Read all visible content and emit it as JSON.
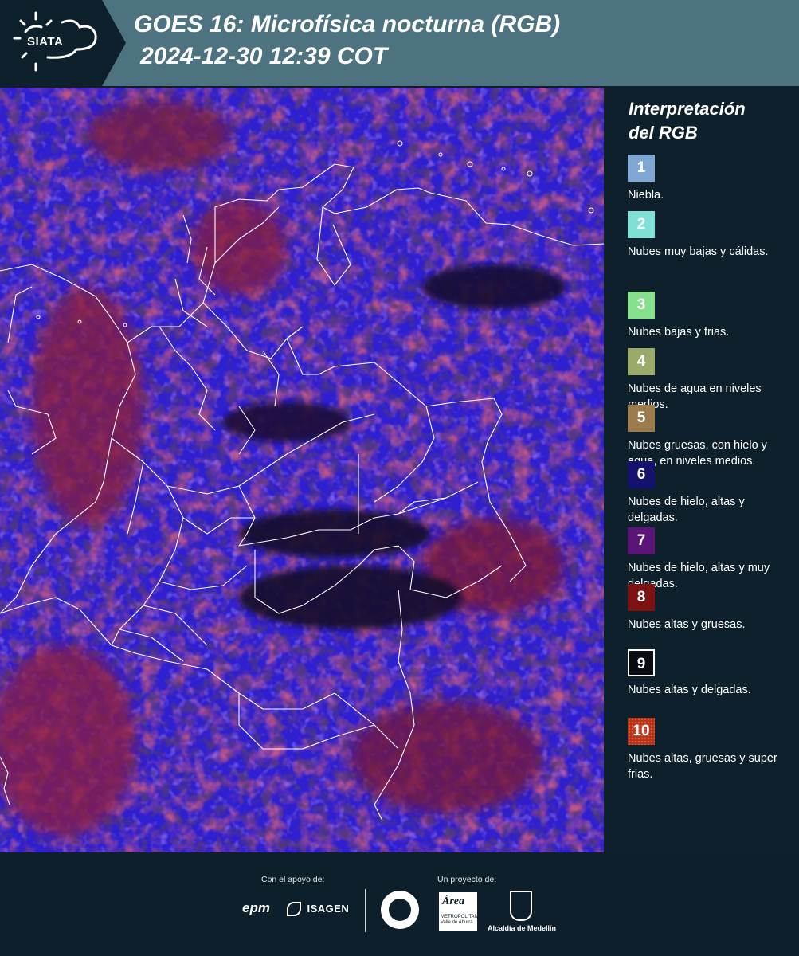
{
  "header": {
    "logo_text": "SIATA",
    "title_line1": "GOES 16: Microfísica nocturna (RGB)",
    "title_line2": "2024-12-30 12:39 COT"
  },
  "map": {
    "icon": "satellite-rgb-image",
    "colors": {
      "background": "#2e1fd0",
      "thick_clouds": "#8e1f3a",
      "thin_clouds": "#1a0f38",
      "borders": "#ffffff"
    }
  },
  "legend": {
    "title_line1": "Interpretación",
    "title_line2": "del RGB",
    "items": [
      {
        "num": "1",
        "label": "Niebla.",
        "color": "#7ea7d3"
      },
      {
        "num": "2",
        "label": "Nubes muy bajas y cálidas.",
        "color": "#7fe0d6"
      },
      {
        "num": "3",
        "label": "Nubes bajas y frias.",
        "color": "#86e08c"
      },
      {
        "num": "4",
        "label": "Nubes de agua en niveles medios.",
        "color": "#9aaa68"
      },
      {
        "num": "5",
        "label": "Nubes gruesas, con hielo y agua, en niveles medios.",
        "color": "#9c7c4c"
      },
      {
        "num": "6",
        "label": "Nubes de hielo, altas y delgadas.",
        "color": "#14126e"
      },
      {
        "num": "7",
        "label": "Nubes de hielo, altas y muy delgadas.",
        "color": "#5b1478"
      },
      {
        "num": "8",
        "label": "Nubes altas y gruesas.",
        "color": "#7d1212"
      },
      {
        "num": "9",
        "label": "Nubes altas y delgadas.",
        "color": "#0a0a14"
      },
      {
        "num": "10",
        "label": "Nubes altas, gruesas y super frias.",
        "color": "#b4321e"
      }
    ]
  },
  "footer": {
    "support_label": "Con el apoyo de:",
    "project_label": "Un proyecto de:",
    "sponsors": [
      "epm",
      "ISAGEN"
    ],
    "partners": [
      "Área Metropolitana Valle de Aburrá",
      "Alcaldía de Medellín"
    ],
    "partner_caption": "Alcaldía de Medellín"
  }
}
